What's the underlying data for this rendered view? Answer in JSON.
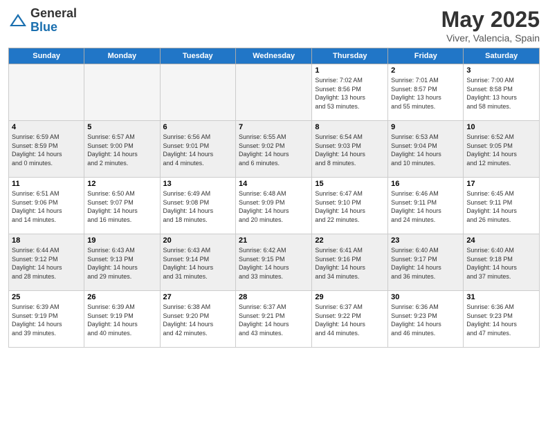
{
  "logo": {
    "general": "General",
    "blue": "Blue"
  },
  "title": {
    "month_year": "May 2025",
    "location": "Viver, Valencia, Spain"
  },
  "headers": [
    "Sunday",
    "Monday",
    "Tuesday",
    "Wednesday",
    "Thursday",
    "Friday",
    "Saturday"
  ],
  "weeks": [
    [
      {
        "day": "",
        "info": ""
      },
      {
        "day": "",
        "info": ""
      },
      {
        "day": "",
        "info": ""
      },
      {
        "day": "",
        "info": ""
      },
      {
        "day": "1",
        "info": "Sunrise: 7:02 AM\nSunset: 8:56 PM\nDaylight: 13 hours\nand 53 minutes."
      },
      {
        "day": "2",
        "info": "Sunrise: 7:01 AM\nSunset: 8:57 PM\nDaylight: 13 hours\nand 55 minutes."
      },
      {
        "day": "3",
        "info": "Sunrise: 7:00 AM\nSunset: 8:58 PM\nDaylight: 13 hours\nand 58 minutes."
      }
    ],
    [
      {
        "day": "4",
        "info": "Sunrise: 6:59 AM\nSunset: 8:59 PM\nDaylight: 14 hours\nand 0 minutes."
      },
      {
        "day": "5",
        "info": "Sunrise: 6:57 AM\nSunset: 9:00 PM\nDaylight: 14 hours\nand 2 minutes."
      },
      {
        "day": "6",
        "info": "Sunrise: 6:56 AM\nSunset: 9:01 PM\nDaylight: 14 hours\nand 4 minutes."
      },
      {
        "day": "7",
        "info": "Sunrise: 6:55 AM\nSunset: 9:02 PM\nDaylight: 14 hours\nand 6 minutes."
      },
      {
        "day": "8",
        "info": "Sunrise: 6:54 AM\nSunset: 9:03 PM\nDaylight: 14 hours\nand 8 minutes."
      },
      {
        "day": "9",
        "info": "Sunrise: 6:53 AM\nSunset: 9:04 PM\nDaylight: 14 hours\nand 10 minutes."
      },
      {
        "day": "10",
        "info": "Sunrise: 6:52 AM\nSunset: 9:05 PM\nDaylight: 14 hours\nand 12 minutes."
      }
    ],
    [
      {
        "day": "11",
        "info": "Sunrise: 6:51 AM\nSunset: 9:06 PM\nDaylight: 14 hours\nand 14 minutes."
      },
      {
        "day": "12",
        "info": "Sunrise: 6:50 AM\nSunset: 9:07 PM\nDaylight: 14 hours\nand 16 minutes."
      },
      {
        "day": "13",
        "info": "Sunrise: 6:49 AM\nSunset: 9:08 PM\nDaylight: 14 hours\nand 18 minutes."
      },
      {
        "day": "14",
        "info": "Sunrise: 6:48 AM\nSunset: 9:09 PM\nDaylight: 14 hours\nand 20 minutes."
      },
      {
        "day": "15",
        "info": "Sunrise: 6:47 AM\nSunset: 9:10 PM\nDaylight: 14 hours\nand 22 minutes."
      },
      {
        "day": "16",
        "info": "Sunrise: 6:46 AM\nSunset: 9:11 PM\nDaylight: 14 hours\nand 24 minutes."
      },
      {
        "day": "17",
        "info": "Sunrise: 6:45 AM\nSunset: 9:11 PM\nDaylight: 14 hours\nand 26 minutes."
      }
    ],
    [
      {
        "day": "18",
        "info": "Sunrise: 6:44 AM\nSunset: 9:12 PM\nDaylight: 14 hours\nand 28 minutes."
      },
      {
        "day": "19",
        "info": "Sunrise: 6:43 AM\nSunset: 9:13 PM\nDaylight: 14 hours\nand 29 minutes."
      },
      {
        "day": "20",
        "info": "Sunrise: 6:43 AM\nSunset: 9:14 PM\nDaylight: 14 hours\nand 31 minutes."
      },
      {
        "day": "21",
        "info": "Sunrise: 6:42 AM\nSunset: 9:15 PM\nDaylight: 14 hours\nand 33 minutes."
      },
      {
        "day": "22",
        "info": "Sunrise: 6:41 AM\nSunset: 9:16 PM\nDaylight: 14 hours\nand 34 minutes."
      },
      {
        "day": "23",
        "info": "Sunrise: 6:40 AM\nSunset: 9:17 PM\nDaylight: 14 hours\nand 36 minutes."
      },
      {
        "day": "24",
        "info": "Sunrise: 6:40 AM\nSunset: 9:18 PM\nDaylight: 14 hours\nand 37 minutes."
      }
    ],
    [
      {
        "day": "25",
        "info": "Sunrise: 6:39 AM\nSunset: 9:19 PM\nDaylight: 14 hours\nand 39 minutes."
      },
      {
        "day": "26",
        "info": "Sunrise: 6:39 AM\nSunset: 9:19 PM\nDaylight: 14 hours\nand 40 minutes."
      },
      {
        "day": "27",
        "info": "Sunrise: 6:38 AM\nSunset: 9:20 PM\nDaylight: 14 hours\nand 42 minutes."
      },
      {
        "day": "28",
        "info": "Sunrise: 6:37 AM\nSunset: 9:21 PM\nDaylight: 14 hours\nand 43 minutes."
      },
      {
        "day": "29",
        "info": "Sunrise: 6:37 AM\nSunset: 9:22 PM\nDaylight: 14 hours\nand 44 minutes."
      },
      {
        "day": "30",
        "info": "Sunrise: 6:36 AM\nSunset: 9:23 PM\nDaylight: 14 hours\nand 46 minutes."
      },
      {
        "day": "31",
        "info": "Sunrise: 6:36 AM\nSunset: 9:23 PM\nDaylight: 14 hours\nand 47 minutes."
      }
    ]
  ]
}
